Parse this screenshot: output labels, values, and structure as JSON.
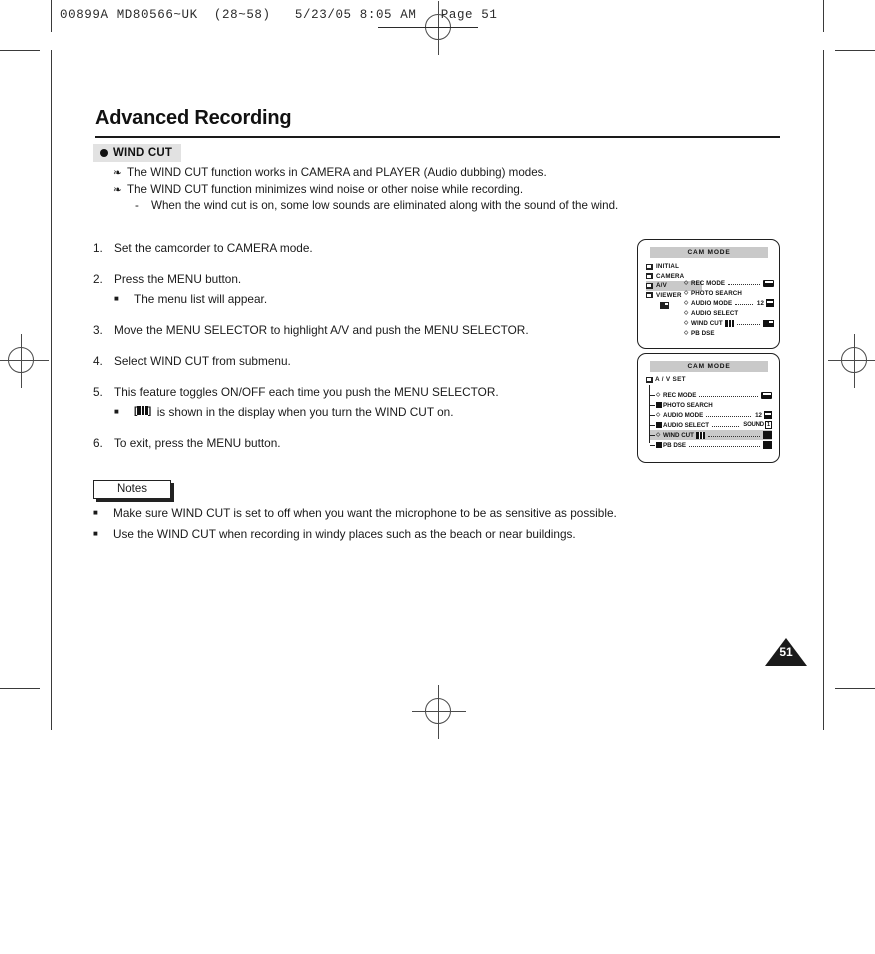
{
  "print_header": {
    "text": "00899A MD80566~UK  (28~58)   5/23/05 8:05 AM   Page 51"
  },
  "page": {
    "title": "Advanced Recording",
    "number": "51"
  },
  "section": {
    "label": "WIND CUT",
    "bullet_icon": "filled-circle-icon"
  },
  "intro": {
    "bullets": [
      "The WIND CUT function works in CAMERA and PLAYER (Audio dubbing) modes.",
      "The WIND CUT function minimizes wind noise or other noise while recording."
    ],
    "sub_note": {
      "dash": "-",
      "text": "When the wind cut is on, some low sounds are eliminated along with the sound of the wind."
    },
    "bullet_icon": "clover-bullet-icon"
  },
  "steps": [
    {
      "num": "1.",
      "text": "Set the camcorder to CAMERA mode.",
      "sub": []
    },
    {
      "num": "2.",
      "text": "Press the MENU button.",
      "sub": [
        {
          "text": "The menu list will appear."
        }
      ]
    },
    {
      "num": "3.",
      "text": "Move the MENU SELECTOR to highlight A/V and push the MENU SELECTOR.",
      "sub": []
    },
    {
      "num": "4.",
      "text": "Select WIND CUT from submenu.",
      "sub": []
    },
    {
      "num": "5.",
      "text": "This feature toggles ON/OFF each time you push the MENU SELECTOR.",
      "sub": [
        {
          "icon": "wind-cut-icon",
          "text": "is shown in the display when you turn the WIND CUT on."
        }
      ]
    },
    {
      "num": "6.",
      "text": "To exit, press the MENU button.",
      "sub": []
    }
  ],
  "notes": {
    "label": "Notes",
    "items": [
      "Make sure WIND CUT is set to off when you want the microphone to be as sensitive as possible.",
      "Use the WIND CUT when recording in windy places such as the beach or near buildings."
    ]
  },
  "lcd_top": {
    "titlebar": "CAM  MODE",
    "tree": [
      {
        "label": "INITIAL",
        "selected": false,
        "icon": "folder-icon"
      },
      {
        "label": "CAMERA",
        "selected": false,
        "icon": "folder-icon"
      },
      {
        "label": "A/V",
        "selected": true,
        "icon": "folder-icon"
      },
      {
        "label": "VIEWER",
        "selected": false,
        "icon": "folder-icon"
      }
    ],
    "cursor_icon": "cursor-block-icon",
    "menu": [
      {
        "label": "REC MODE",
        "dots": true,
        "value": "",
        "value_icon": "cassette-icon"
      },
      {
        "label": "PHOTO SEARCH",
        "dots": false,
        "value": "",
        "value_icon": ""
      },
      {
        "label": "AUDIO MODE",
        "dots": true,
        "value": "12",
        "value_icon": "bit-icon"
      },
      {
        "label": "AUDIO SELECT",
        "dots": false,
        "value": "",
        "value_icon": ""
      },
      {
        "label": "WIND CUT",
        "dots": true,
        "value": "",
        "value_icon": "speaker-icon",
        "label_icon": "wind-cut-icon"
      },
      {
        "label": "PB DSE",
        "dots": false,
        "value": "",
        "value_icon": ""
      }
    ]
  },
  "lcd_bottom": {
    "titlebar": "CAM  MODE",
    "heading": "A / V SET",
    "heading_icon": "folder-icon",
    "menu": [
      {
        "label": "REC MODE",
        "dots": true,
        "value": "",
        "value_icon": "cassette-icon",
        "selected": false
      },
      {
        "label": "PHOTO SEARCH",
        "dots": false,
        "value": "",
        "value_icon": "",
        "selected": false
      },
      {
        "label": "AUDIO MODE",
        "dots": true,
        "value": "12",
        "value_icon": "bit-icon",
        "selected": false
      },
      {
        "label": "AUDIO SELECT",
        "dots": true,
        "value": "SOUND",
        "value_box": "1",
        "value_icon": "",
        "selected": false
      },
      {
        "label": "WIND CUT",
        "dots": true,
        "value": "",
        "value_icon": "block-icon",
        "label_icon": "wind-cut-icon",
        "selected": true
      },
      {
        "label": "PB DSE",
        "dots": true,
        "value": "",
        "value_icon": "block-icon",
        "selected": false
      }
    ]
  },
  "colors": {
    "ink": "#1a1a1a",
    "chip_gray": "#e2e2e2",
    "lcd_gray": "#c9c9c9"
  }
}
